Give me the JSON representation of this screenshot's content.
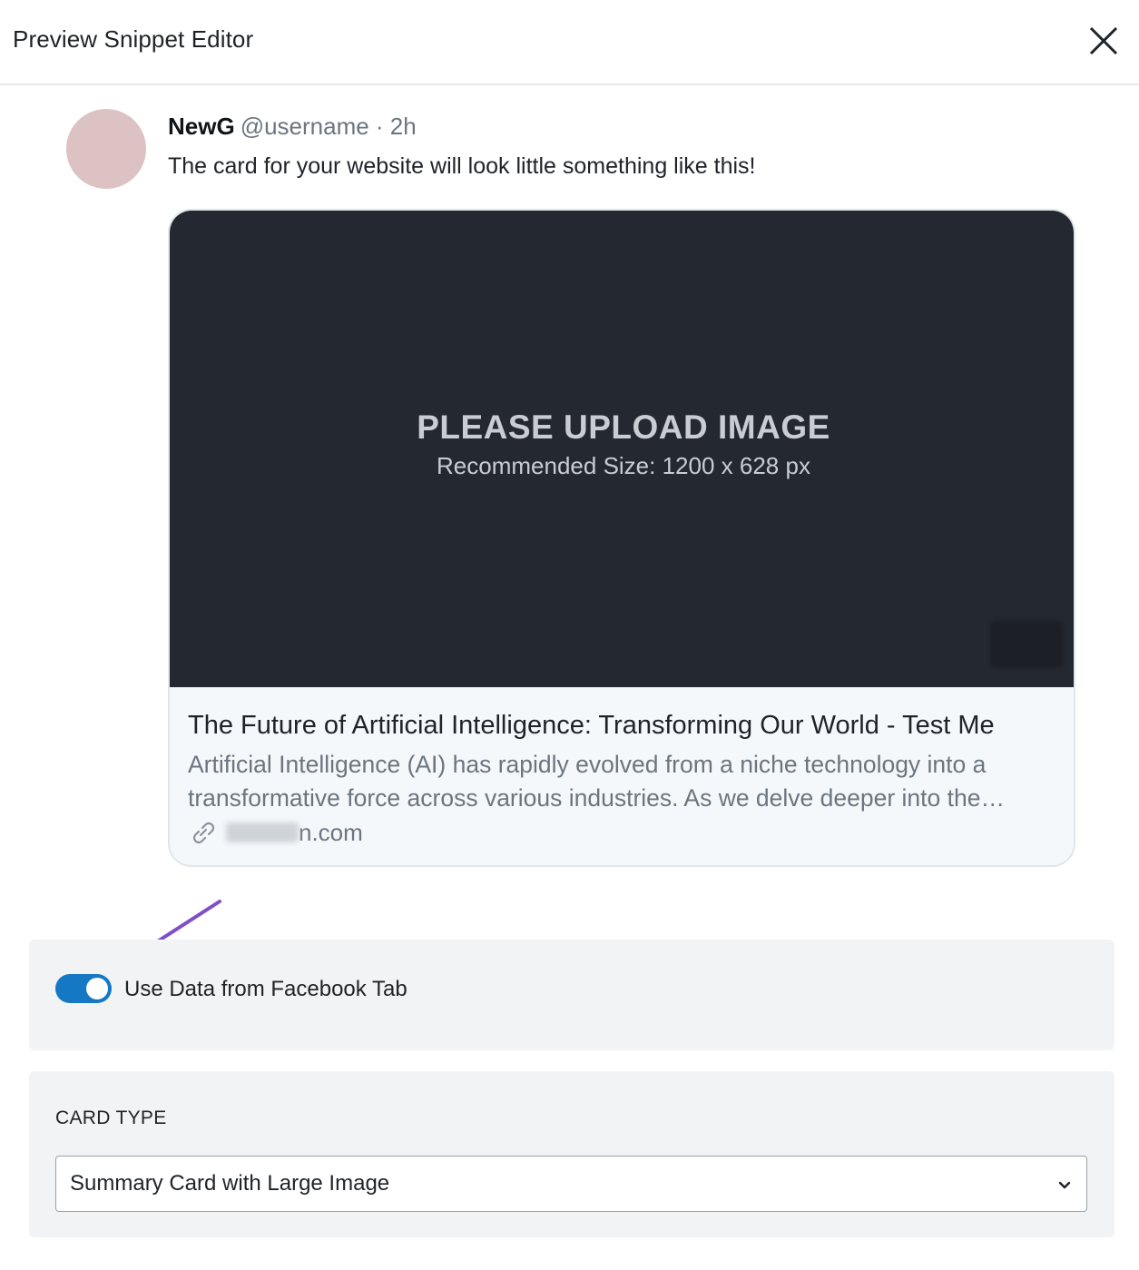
{
  "header": {
    "title": "Preview Snippet Editor",
    "close_icon": "close-icon"
  },
  "tweet": {
    "name": "NewG",
    "meta": "@username · 2h",
    "text": "The card for your website will look little something like this!"
  },
  "card": {
    "image_title": "PLEASE UPLOAD IMAGE",
    "image_sub": "Recommended Size: 1200 x 628 px",
    "title": "The Future of Artificial Intelligence: Transforming Our World - Test Me",
    "description": "Artificial Intelligence (AI) has rapidly evolved from a niche technology into a transformative force across various industries. As we delve deeper into the implications of AI",
    "domain_suffix": "n.com",
    "link_icon": "link-icon"
  },
  "settings": {
    "toggle_label": "Use Data from Facebook Tab",
    "toggle_on": true,
    "card_type_label": "CARD TYPE",
    "card_type_value": "Summary Card with Large Image"
  },
  "colors": {
    "accent": "#1578c4",
    "annotation_arrow": "#7e4fc7",
    "image_bg": "#242830"
  }
}
